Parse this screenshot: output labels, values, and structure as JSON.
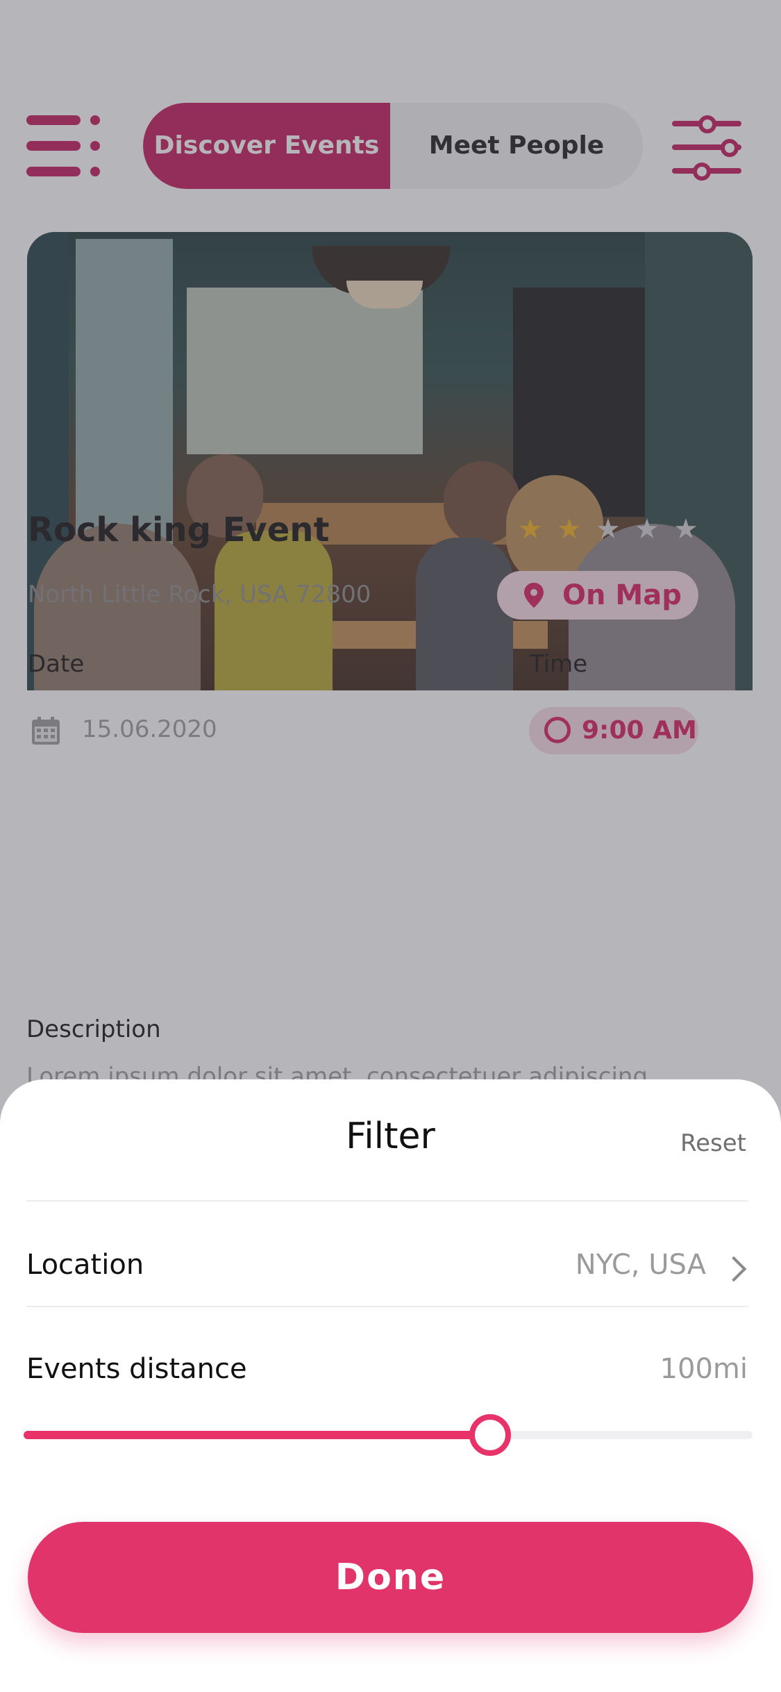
{
  "header": {
    "tabs": [
      {
        "label": "Discover Events",
        "active": true
      },
      {
        "label": "Meet People",
        "active": false
      }
    ]
  },
  "event": {
    "title": "Rock king Event",
    "rating": 2,
    "rating_max": 5,
    "address": "North Little Rock, USA 72800",
    "map_button": "On Map",
    "date_label": "Date",
    "date_value": "15.06.2020",
    "time_label": "Time",
    "time_value": "9:00 AM",
    "description_label": "Description",
    "description_text": "Lorem ipsum dolor sit amet, consectetuer adipiscing"
  },
  "filter": {
    "title": "Filter",
    "reset_label": "Reset",
    "location_label": "Location",
    "location_value": "NYC, USA",
    "distance_label": "Events distance",
    "distance_value": "100mi",
    "distance_fraction": 0.64,
    "done_label": "Done"
  },
  "colors": {
    "accent": "#c2185b",
    "accent_bright": "#e8336a",
    "star_on": "#f2b01e",
    "star_off": "#d0d0d0"
  }
}
